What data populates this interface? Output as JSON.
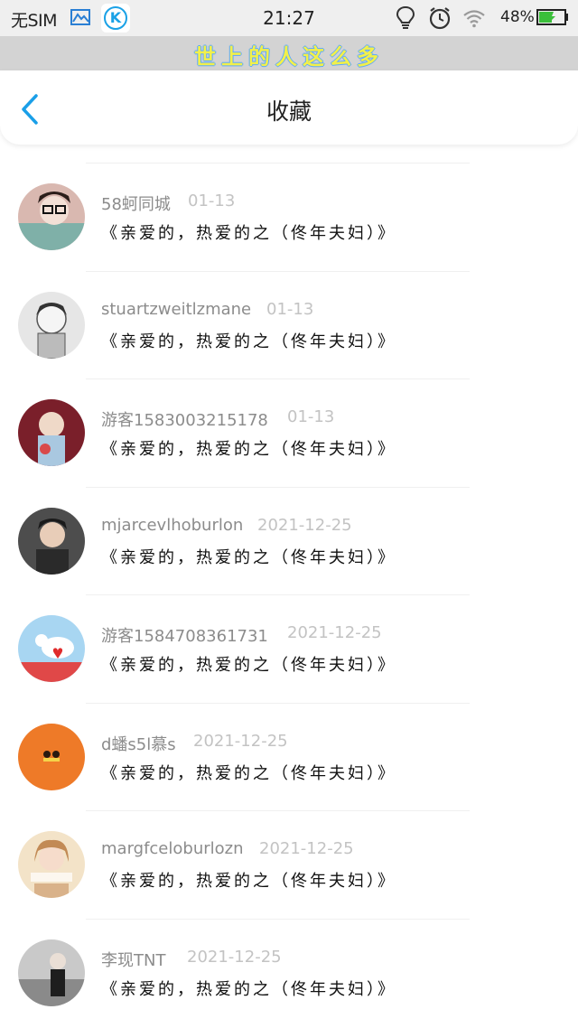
{
  "status_bar": {
    "carrier": "无SIM",
    "time": "21:27",
    "battery": "48%",
    "app_icon_letter": "K"
  },
  "banner": {
    "text": "世上的人这么多"
  },
  "header": {
    "title": "收藏",
    "back_icon": "chevron-left-icon"
  },
  "colors": {
    "accent": "#1a9fe8",
    "name": "#8c8c8c",
    "date": "#c3c3c3",
    "banner_bg": "#d3d3d3"
  },
  "favorites": [
    {
      "name": "58蚵同城",
      "date": "01-13",
      "message": "《亲爱的，热爱的之（佟年夫妇）》"
    },
    {
      "name": "stuartzweitlzmane",
      "date": "01-13",
      "message": "《亲爱的，热爱的之（佟年夫妇）》"
    },
    {
      "name": "游客1583003215178",
      "date": "01-13",
      "message": "《亲爱的，热爱的之（佟年夫妇）》"
    },
    {
      "name": "mjarcevlhoburlon",
      "date": "2021-12-25",
      "message": "《亲爱的，热爱的之（佟年夫妇）》"
    },
    {
      "name": "游客1584708361731",
      "date": "2021-12-25",
      "message": "《亲爱的，热爱的之（佟年夫妇）》"
    },
    {
      "name": "d蟠s5l慕s",
      "date": "2021-12-25",
      "message": "《亲爱的，热爱的之（佟年夫妇）》"
    },
    {
      "name": "margfceloburlozn",
      "date": "2021-12-25",
      "message": "《亲爱的，热爱的之（佟年夫妇）》"
    },
    {
      "name": "李现TNT",
      "date": "2021-12-25",
      "message": "《亲爱的，热爱的之（佟年夫妇）》"
    }
  ]
}
